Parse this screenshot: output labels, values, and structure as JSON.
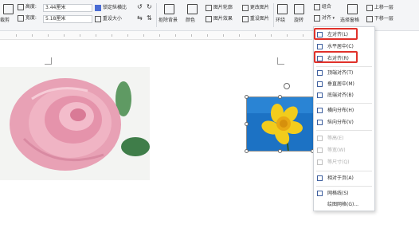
{
  "toolbar": {
    "row1": {
      "height_label": "高度:",
      "height_value": "3.44厘米",
      "lock_ratio": "锁定纵横比",
      "picture_outline": "图片轮廓",
      "change_picture": "更改图片",
      "combine": "组合",
      "bring_forward": "上移一层"
    },
    "row2": {
      "crop": "裁剪",
      "width_label": "宽度:",
      "width_value": "5.18厘米",
      "reset_size": "重设大小",
      "remove_bg": "抠除背景",
      "color": "颜色",
      "picture_effects": "图片效果",
      "reset_picture": "重设图片",
      "wrap": "环绕",
      "rotate": "旋转",
      "align": "对齐",
      "selection_pane": "选择窗格",
      "send_backward": "下移一层"
    }
  },
  "align_menu": {
    "items": [
      {
        "label": "左对齐(L)",
        "enabled": true,
        "highlighted": true
      },
      {
        "label": "水平居中(C)",
        "enabled": true,
        "highlighted": false
      },
      {
        "label": "右对齐(R)",
        "enabled": true,
        "highlighted": true
      },
      {
        "label": "顶端对齐(T)",
        "enabled": true,
        "highlighted": false
      },
      {
        "label": "垂直居中(M)",
        "enabled": true,
        "highlighted": false
      },
      {
        "label": "底端对齐(B)",
        "enabled": true,
        "highlighted": false
      },
      {
        "label": "横向分布(H)",
        "enabled": true,
        "highlighted": false
      },
      {
        "label": "纵向分布(V)",
        "enabled": true,
        "highlighted": false
      },
      {
        "label": "等高(E)",
        "enabled": false,
        "highlighted": false
      },
      {
        "label": "等宽(W)",
        "enabled": false,
        "highlighted": false
      },
      {
        "label": "等尺寸(Q)",
        "enabled": false,
        "highlighted": false
      },
      {
        "label": "相对于页(A)",
        "enabled": true,
        "highlighted": false
      },
      {
        "label": "网格线(S)",
        "enabled": true,
        "highlighted": false
      },
      {
        "label": "绘图网格(G)...",
        "enabled": true,
        "highlighted": false
      }
    ]
  },
  "colors": {
    "highlight": "#e0312a",
    "menu_icon": "#3e5f9e",
    "sky_blue": "#1c72c4",
    "daffodil": "#f2cc1c"
  }
}
